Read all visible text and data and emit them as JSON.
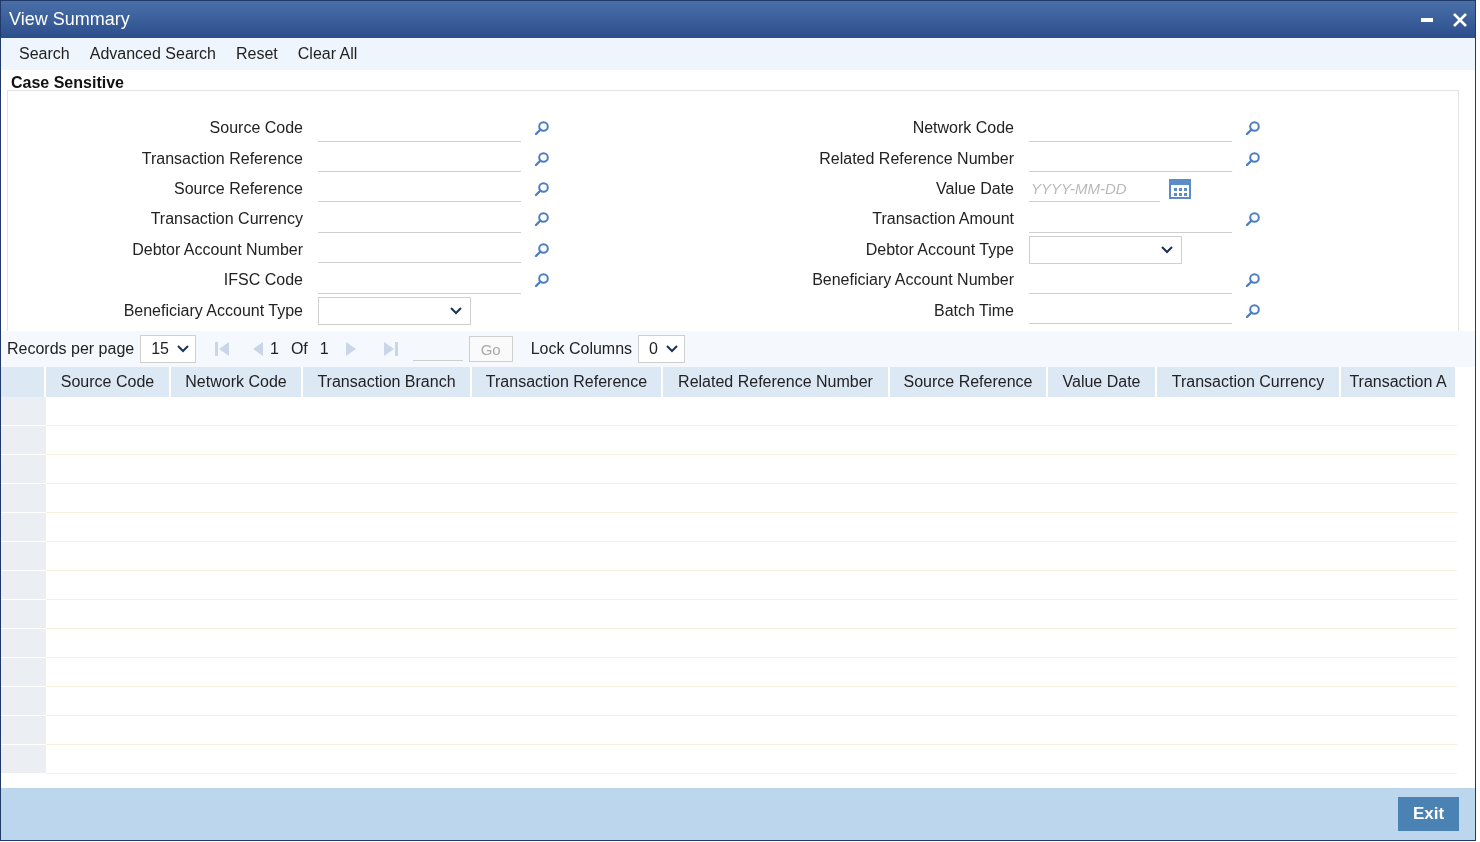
{
  "window": {
    "title": "View Summary"
  },
  "menu": [
    "Search",
    "Advanced Search",
    "Reset",
    "Clear All"
  ],
  "section": {
    "title": "Case Sensitive"
  },
  "fields_left": [
    {
      "label": "Source Code",
      "kind": "lookup"
    },
    {
      "label": "Transaction Reference",
      "kind": "lookup"
    },
    {
      "label": "Source Reference",
      "kind": "lookup"
    },
    {
      "label": "Transaction Currency",
      "kind": "lookup"
    },
    {
      "label": "Debtor Account Number",
      "kind": "lookup"
    },
    {
      "label": "IFSC Code",
      "kind": "lookup"
    },
    {
      "label": "Beneficiary Account Type",
      "kind": "select"
    },
    {
      "kind": "partial"
    }
  ],
  "fields_right": [
    {
      "label": "Network Code",
      "kind": "lookup"
    },
    {
      "label": "Related Reference Number",
      "kind": "lookup"
    },
    {
      "label": "Value Date",
      "kind": "date",
      "placeholder": "YYYY-MM-DD"
    },
    {
      "label": "Transaction Amount",
      "kind": "lookup"
    },
    {
      "label": "Debtor Account Type",
      "kind": "select"
    },
    {
      "label": "Beneficiary Account Number",
      "kind": "lookup"
    },
    {
      "label": "Batch Time",
      "kind": "lookup"
    },
    {
      "kind": "partial"
    }
  ],
  "pager": {
    "records_label": "Records per page",
    "records_value": "15",
    "page": "1",
    "of_label": "Of",
    "total": "1",
    "go": "Go",
    "lock_label": "Lock Columns",
    "lock_value": "0"
  },
  "table": {
    "columns": [
      "Source Code",
      "Network Code",
      "Transaction Branch",
      "Transaction Reference",
      "Related Reference Number",
      "Source Reference",
      "Value Date",
      "Transaction Currency",
      "Transaction A"
    ]
  },
  "footer": {
    "exit": "Exit"
  }
}
